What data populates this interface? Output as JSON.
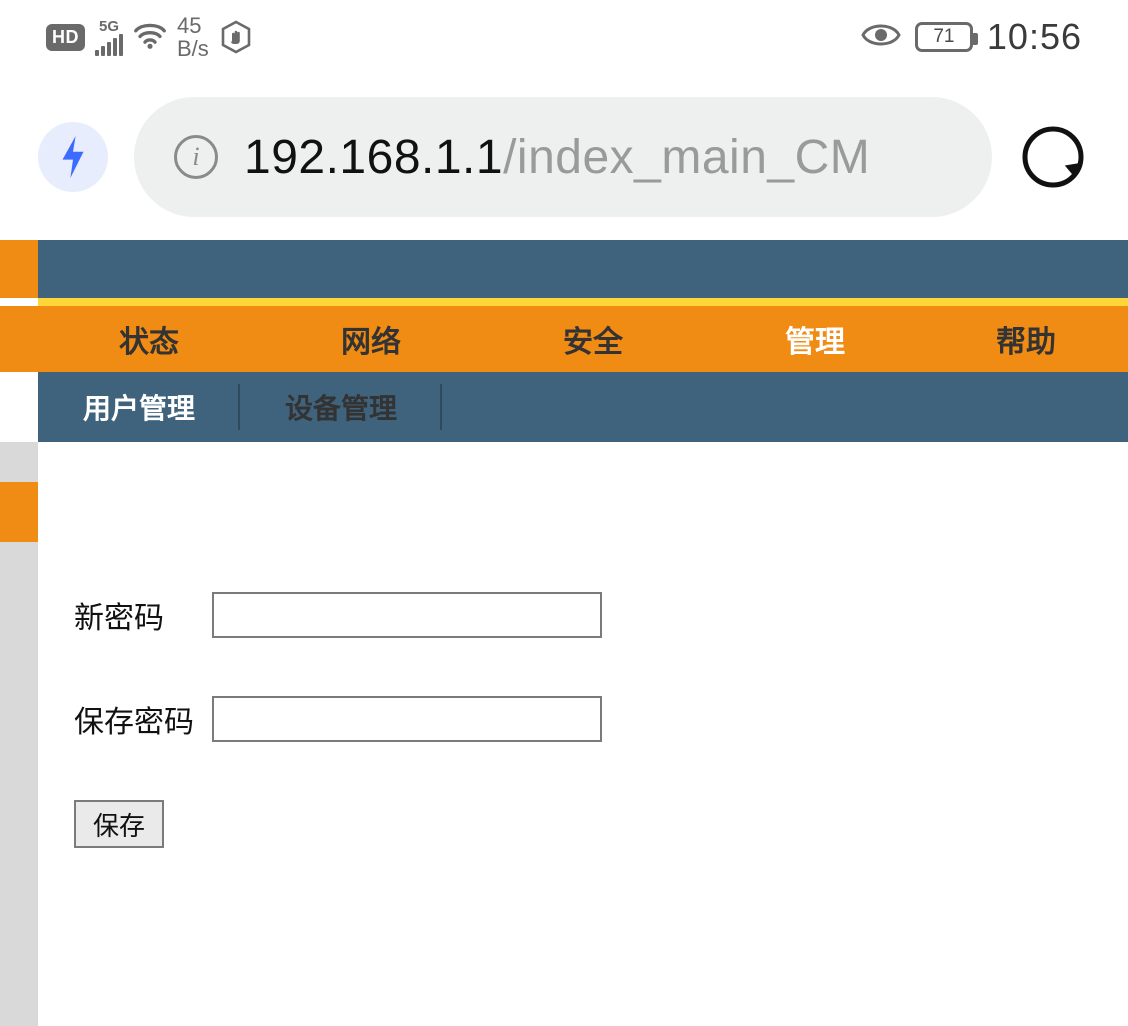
{
  "status_bar": {
    "hd_badge": "HD",
    "network_tech": "5G",
    "speed_value": "45",
    "speed_unit": "B/s",
    "battery_pct": "71",
    "time": "10:56"
  },
  "browser": {
    "url_host": "192.168.1.1",
    "url_path": "/index_main_CM"
  },
  "nav": {
    "items": [
      {
        "label": "状态"
      },
      {
        "label": "网络"
      },
      {
        "label": "安全"
      },
      {
        "label": "管理",
        "active": true
      },
      {
        "label": "帮助"
      }
    ]
  },
  "subnav": {
    "items": [
      {
        "label": "用户管理",
        "active": true
      },
      {
        "label": "设备管理"
      }
    ]
  },
  "form": {
    "new_password_label": "新密码",
    "confirm_password_label": "保存密码",
    "save_button": "保存"
  }
}
